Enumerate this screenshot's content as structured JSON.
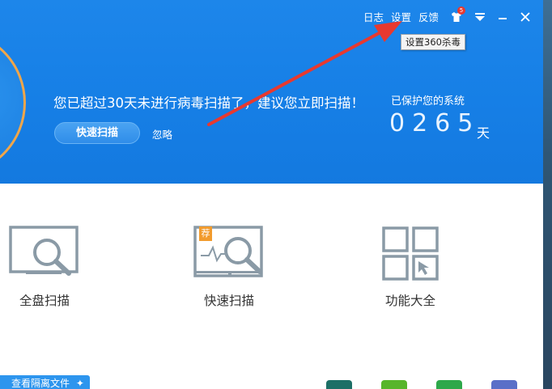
{
  "topbar": {
    "log_label": "日志",
    "settings_label": "设置",
    "feedback_label": "反馈",
    "notification_count": "5"
  },
  "tooltip": {
    "text": "设置360杀毒"
  },
  "hero": {
    "message": "您已超过30天未进行病毒扫描了，建议您立即扫描！",
    "scan_button": "快速扫描",
    "ignore_link": "忽略",
    "protect_label": "已保护您的系统",
    "days_value": "0265",
    "days_unit": "天"
  },
  "features": [
    {
      "label": "全盘扫描",
      "icon": "monitor-search-icon"
    },
    {
      "label": "快速扫描",
      "icon": "quick-scan-icon",
      "badge": "荐"
    },
    {
      "label": "功能大全",
      "icon": "grid-tools-icon"
    }
  ],
  "bottom": {
    "quarantine_label": "查看隔离文件",
    "tools": [
      {
        "icon": "shield-tool-icon",
        "color": "#1d6f66"
      },
      {
        "icon": "apps-tool-icon",
        "color": "#58b52b"
      },
      {
        "icon": "chat-tool-icon",
        "color": "#2ea84a"
      },
      {
        "icon": "home-tool-icon",
        "color": "#5a6fc8"
      }
    ]
  },
  "colors": {
    "header_blue": "#1782e8",
    "ring_orange": "#f0a64a",
    "arrow_red": "#e8392f"
  }
}
